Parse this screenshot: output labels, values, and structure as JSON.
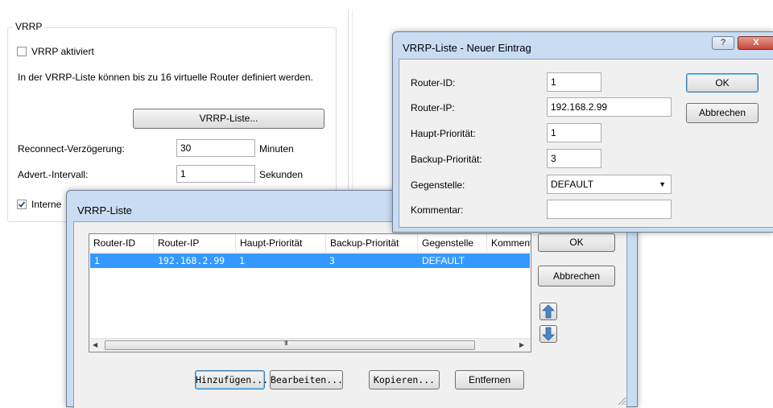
{
  "vrrp_panel": {
    "group_title": "VRRP",
    "enable_label": "VRRP aktiviert",
    "info_text": "In der VRRP-Liste können bis zu 16 virtuelle Router definiert werden.",
    "list_button": "VRRP-Liste...",
    "reconnect_label": "Reconnect-Verzögerung:",
    "reconnect_value": "30",
    "reconnect_unit": "Minuten",
    "advert_label": "Advert.-Intervall:",
    "advert_value": "1",
    "advert_unit": "Sekunden",
    "internal_label": "Interne",
    "internal_checked": true
  },
  "new_entry_dialog": {
    "title": "VRRP-Liste - Neuer Eintrag",
    "help_button": "?",
    "close_button": "X",
    "fields": [
      {
        "label": "Router-ID:",
        "value": "1"
      },
      {
        "label": "Router-IP:",
        "value": "192.168.2.99"
      },
      {
        "label": "Haupt-Priorität:",
        "value": "1"
      },
      {
        "label": "Backup-Priorität:",
        "value": "3"
      },
      {
        "label": "Gegenstelle:",
        "value": "DEFAULT"
      },
      {
        "label": "Kommentar:",
        "value": ""
      }
    ],
    "ok_button": "OK",
    "cancel_button": "Abbrechen"
  },
  "list_dialog": {
    "title": "VRRP-Liste",
    "columns": [
      "Router-ID",
      "Router-IP",
      "Haupt-Priorität",
      "Backup-Priorität",
      "Gegenstelle",
      "Komment"
    ],
    "rows": [
      {
        "router_id": "1",
        "router_ip": "192.168.2.99",
        "haupt": "1",
        "backup": "3",
        "gegenstelle": "DEFAULT",
        "kommentar": ""
      }
    ],
    "ok_button": "OK",
    "cancel_button": "Abbrechen",
    "add_button": "Hinzufügen...",
    "edit_button": "Bearbeiten...",
    "copy_button": "Kopieren...",
    "remove_button": "Entfernen",
    "scroll_thumb_glyph": "III"
  },
  "colors": {
    "selection": "#3399ff",
    "title_bar": "#c9dcf2",
    "close_button": "#c9463d",
    "arrow_blue": "#4a86c5"
  }
}
